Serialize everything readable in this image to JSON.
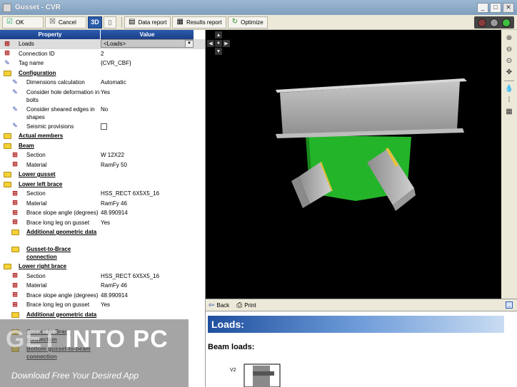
{
  "window": {
    "title": "Gusset - CVR"
  },
  "toolbar": {
    "ok": "OK",
    "cancel": "Cancel",
    "view3d": "3D",
    "data_report": "Data report",
    "results_report": "Results report",
    "optimize": "Optimize"
  },
  "properties": {
    "header_property": "Property",
    "header_value": "Value",
    "rows": [
      {
        "label": "Loads",
        "value": "<Loads>",
        "indent": 0,
        "icon": "toggle",
        "selected": true
      },
      {
        "label": "Connection ID",
        "value": "2",
        "indent": 0,
        "icon": "toggle"
      },
      {
        "label": "Tag name",
        "value": "{CVR_CBF}",
        "indent": 0,
        "icon": "pen"
      },
      {
        "label": "Configuration",
        "value": "",
        "indent": 0,
        "icon": "folder",
        "section": true
      },
      {
        "label": "Dimensions calculation",
        "value": "Automatic",
        "indent": 1,
        "icon": "pen"
      },
      {
        "label": "Consider hole deformation in bolts",
        "value": "Yes",
        "indent": 1,
        "icon": "pen",
        "tall": true
      },
      {
        "label": "Consider sheared edges in shapes",
        "value": "No",
        "indent": 1,
        "icon": "pen",
        "tall": true
      },
      {
        "label": "Seismic provisions",
        "value": "",
        "indent": 1,
        "icon": "pen",
        "checkbox": true
      },
      {
        "label": "Actual members",
        "value": "",
        "indent": 0,
        "icon": "folder",
        "section": true
      },
      {
        "label": "Beam",
        "value": "",
        "indent": 0,
        "icon": "folder",
        "section": true
      },
      {
        "label": "Section",
        "value": "W 12X22",
        "indent": 1,
        "icon": "toggle"
      },
      {
        "label": "Material",
        "value": "RamFy 50",
        "indent": 1,
        "icon": "toggle"
      },
      {
        "label": "Lower gusset",
        "value": "",
        "indent": 0,
        "icon": "folder",
        "section": true
      },
      {
        "label": "Lower left brace",
        "value": "",
        "indent": 0,
        "icon": "folder",
        "section": true
      },
      {
        "label": "Section",
        "value": "HSS_RECT 6X5X5_16",
        "indent": 1,
        "icon": "toggle"
      },
      {
        "label": "Material",
        "value": "RamFy 46",
        "indent": 1,
        "icon": "toggle"
      },
      {
        "label": "Brace slope angle (degrees)",
        "value": "48.990914",
        "indent": 1,
        "icon": "toggle"
      },
      {
        "label": "Brace long leg on gusset",
        "value": "Yes",
        "indent": 1,
        "icon": "toggle"
      },
      {
        "label": "Additional geometric data",
        "value": "",
        "indent": 1,
        "icon": "folder",
        "section": true,
        "tall": true
      },
      {
        "label": "Gusset-to-Brace connection",
        "value": "",
        "indent": 1,
        "icon": "folder",
        "section": true,
        "tall": true
      },
      {
        "label": "Lower right brace",
        "value": "",
        "indent": 0,
        "icon": "folder",
        "section": true
      },
      {
        "label": "Section",
        "value": "HSS_RECT 6X5X5_16",
        "indent": 1,
        "icon": "toggle"
      },
      {
        "label": "Material",
        "value": "RamFy 46",
        "indent": 1,
        "icon": "toggle"
      },
      {
        "label": "Brace slope angle (degrees)",
        "value": "48.990914",
        "indent": 1,
        "icon": "toggle"
      },
      {
        "label": "Brace long leg on gusset",
        "value": "Yes",
        "indent": 1,
        "icon": "toggle"
      },
      {
        "label": "Additional geometric data",
        "value": "",
        "indent": 1,
        "icon": "folder",
        "section": true,
        "tall": true
      },
      {
        "label": "Gusset-to-Brace connection",
        "value": "",
        "indent": 1,
        "icon": "folder",
        "section": true,
        "tall": true
      },
      {
        "label": "Bottom gusset-to-beam connection",
        "value": "",
        "indent": 1,
        "icon": "folder",
        "section": true,
        "tall": true
      }
    ]
  },
  "report_bar": {
    "back": "Back",
    "print": "Print"
  },
  "report": {
    "heading": "Loads:",
    "subheading": "Beam loads:",
    "diagram_label": "V2"
  },
  "watermark": {
    "logo_a": "GET ",
    "logo_b": "INTO PC",
    "tagline": "Download Free Your Desired App"
  },
  "colors": {
    "beam": "#a9a9a9",
    "gusset": "#23b429",
    "brace": "#b0b0b0",
    "header_blue": "#1f4f9e",
    "circle_left": "#c0393b",
    "circle_mid": "#c9c9c9",
    "circle_right": "#3ec03e"
  },
  "icons": {
    "ok": "check-icon",
    "cancel": "x-icon",
    "data_report": "document-icon",
    "results_report": "results-icon",
    "optimize": "cycle-icon",
    "back": "back-arrow-icon",
    "print": "printer-icon"
  }
}
